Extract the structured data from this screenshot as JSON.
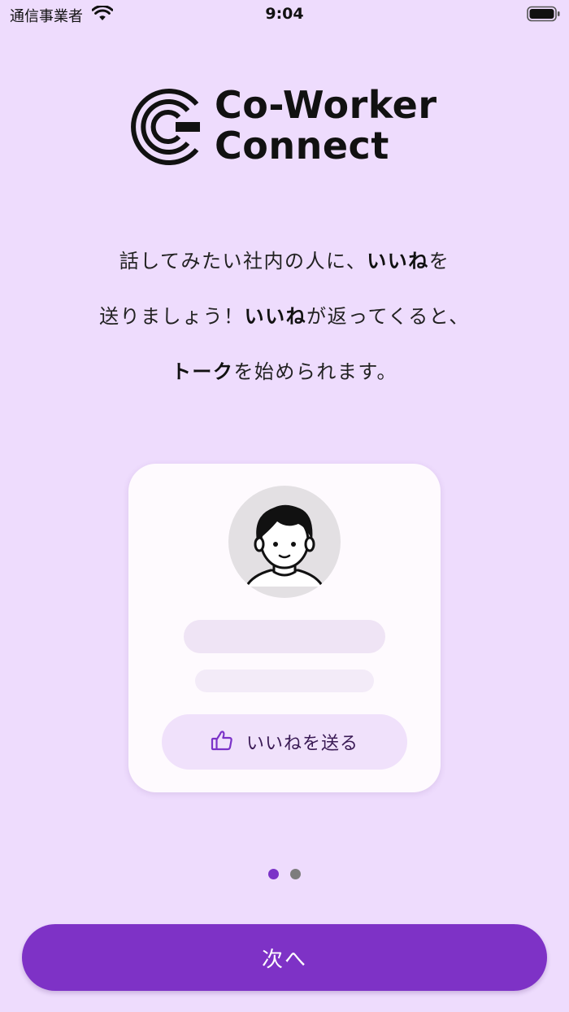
{
  "status_bar": {
    "carrier": "通信事業者",
    "time": "9:04"
  },
  "logo": {
    "line1": "Co-Worker",
    "line2": "Connect"
  },
  "intro": {
    "line1": {
      "before": "話してみたい社内の人に、",
      "strong": "いいね",
      "after": "を"
    },
    "line2": {
      "before": "送りましょう！",
      "strong": "いいね",
      "after": "が返ってくると、"
    },
    "line3": {
      "before": "",
      "strong": "トーク",
      "after": "を始められます。"
    }
  },
  "card": {
    "like_button_label": "いいねを送る"
  },
  "pager": {
    "current_page": 1,
    "total_pages": 2
  },
  "next_button_label": "次へ",
  "colors": {
    "background": "#eedcfd",
    "accent": "#7e32c6",
    "card_background": "#fefafe",
    "like_button_background": "#f0e1fb"
  },
  "icons": {
    "wifi": "wifi-icon",
    "battery": "battery-icon",
    "logo_mark": "co-worker-connect-logo-icon",
    "avatar": "person-avatar-icon",
    "like": "thumbs-up-icon"
  }
}
